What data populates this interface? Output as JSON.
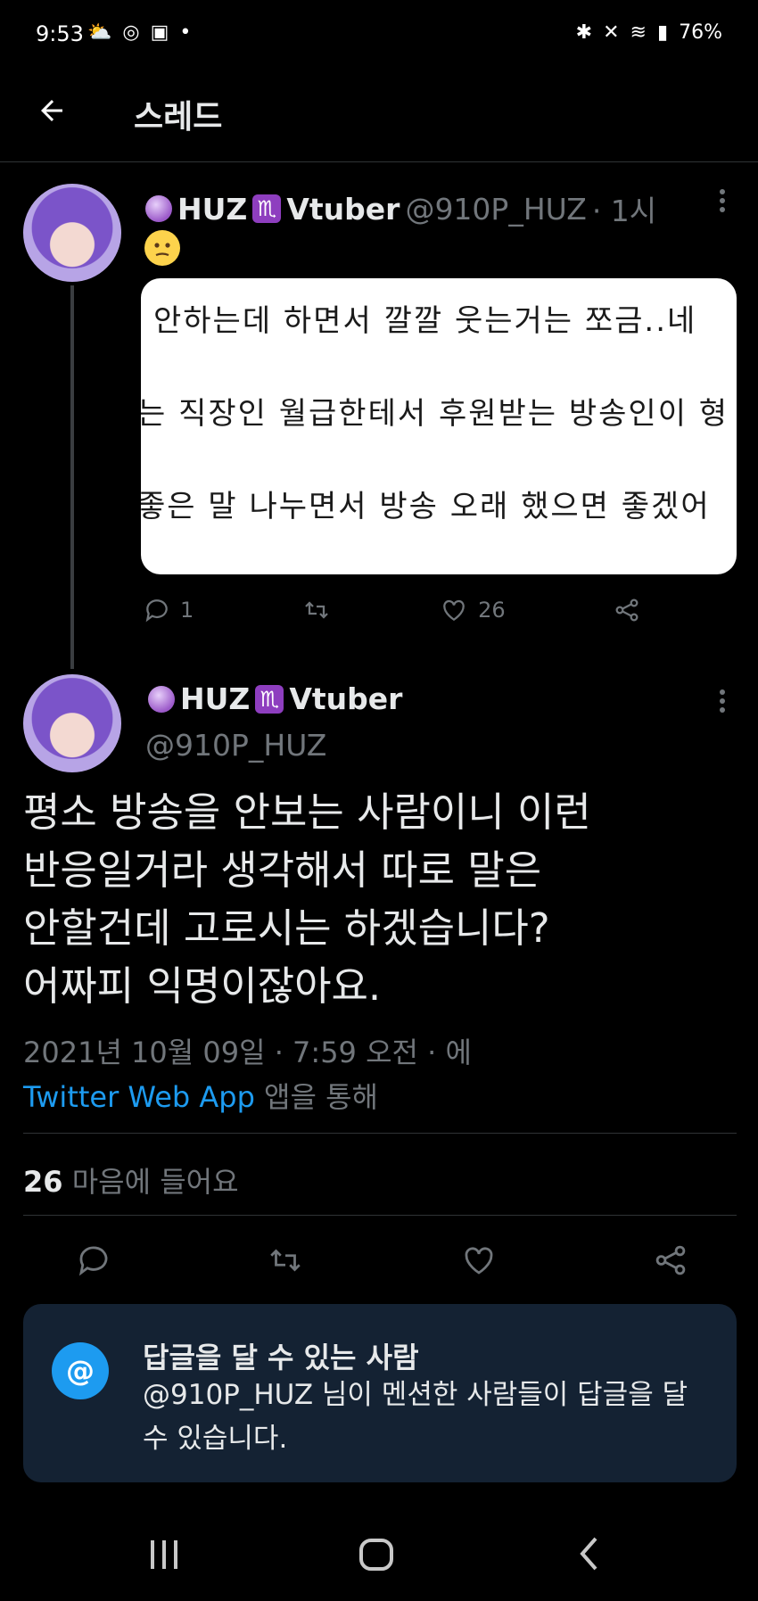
{
  "status_bar": {
    "time": "9:53",
    "battery": "76%"
  },
  "header": {
    "title": "스레드"
  },
  "tweet1": {
    "name": "HUZ",
    "name_suffix": "Vtuber",
    "handle": "@910P_HUZ",
    "time": "· 1시",
    "image_lines": [
      "안하는데 하면서 깔깔 웃는거는 쪼금..네",
      "는 직장인 월급한테서 후원받는 방송인이 형",
      "좋은 말 나누면서 방송 오래 했으면 좋겠어"
    ],
    "replies": "1",
    "likes": "26"
  },
  "tweet2": {
    "name": "HUZ",
    "name_suffix": "Vtuber",
    "handle": "@910P_HUZ",
    "text_lines": [
      "평소 방송을 안보는 사람이니 이런",
      "반응일거라 생각해서 따로 말은",
      "안할건데 고로시는 하겠습니다?",
      "어짜피 익명이잖아요."
    ],
    "date": "2021년 10월 09일 · 7:59 오전 · 에",
    "source": "Twitter Web App",
    "source_suffix": "앱을 통해",
    "likes_count": "26",
    "likes_label": "마음에 들어요"
  },
  "reply_notice": {
    "title": "답글을 달 수 있는 사람",
    "body": "@910P_HUZ 님이 멘션한 사람들이 답글을 달 수 있습니다."
  },
  "colors": {
    "accent": "#1d9bf0",
    "background": "#000000",
    "notice_bg": "#142233"
  },
  "icons": [
    "back-arrow-icon",
    "reply-icon",
    "retweet-icon",
    "like-icon",
    "share-icon",
    "more-icon",
    "mention-icon"
  ]
}
